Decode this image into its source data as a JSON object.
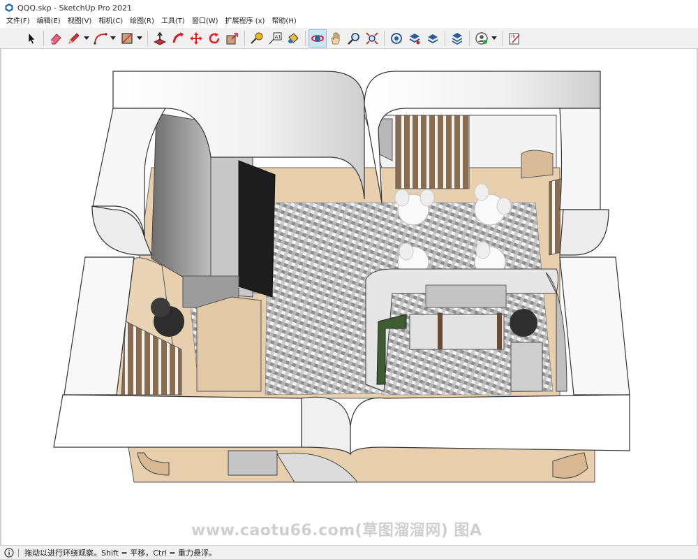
{
  "window": {
    "title": "QQQ.skp - SketchUp Pro 2021"
  },
  "menu": [
    "文件(F)",
    "编辑(E)",
    "视图(V)",
    "相机(C)",
    "绘图(R)",
    "工具(T)",
    "窗口(W)",
    "扩展程序 (x)",
    "帮助(H)"
  ],
  "toolbar": {
    "tools": [
      "select-icon",
      "eraser-icon",
      "pencil-icon",
      "arc-icon",
      "rectangle-icon",
      "push-pull-icon",
      "follow-me-icon",
      "move-icon",
      "rotate-icon",
      "scale-icon",
      "tape-measure-icon",
      "text-icon",
      "paint-bucket-icon",
      "orbit-icon",
      "pan-icon",
      "zoom-icon",
      "zoom-extents-icon",
      "warehouse-icon",
      "extension-warehouse-icon",
      "layout-icon",
      "extension-manager-icon",
      "account-icon",
      "ruby-console-icon"
    ],
    "active_tool": "orbit-icon"
  },
  "watermark": "www.caotu66.com(草图溜溜网) 图A",
  "status": {
    "message": "拖动以进行环绕观察。Shift = 平移，Ctrl = 重力悬浮。"
  },
  "colors": {
    "floor_wood": "#e8cfae",
    "carpet": "#a8a8a8",
    "wall_white": "#ffffff",
    "wall_grey": "#9a9a9a",
    "active_tool": "#cde4f7"
  }
}
